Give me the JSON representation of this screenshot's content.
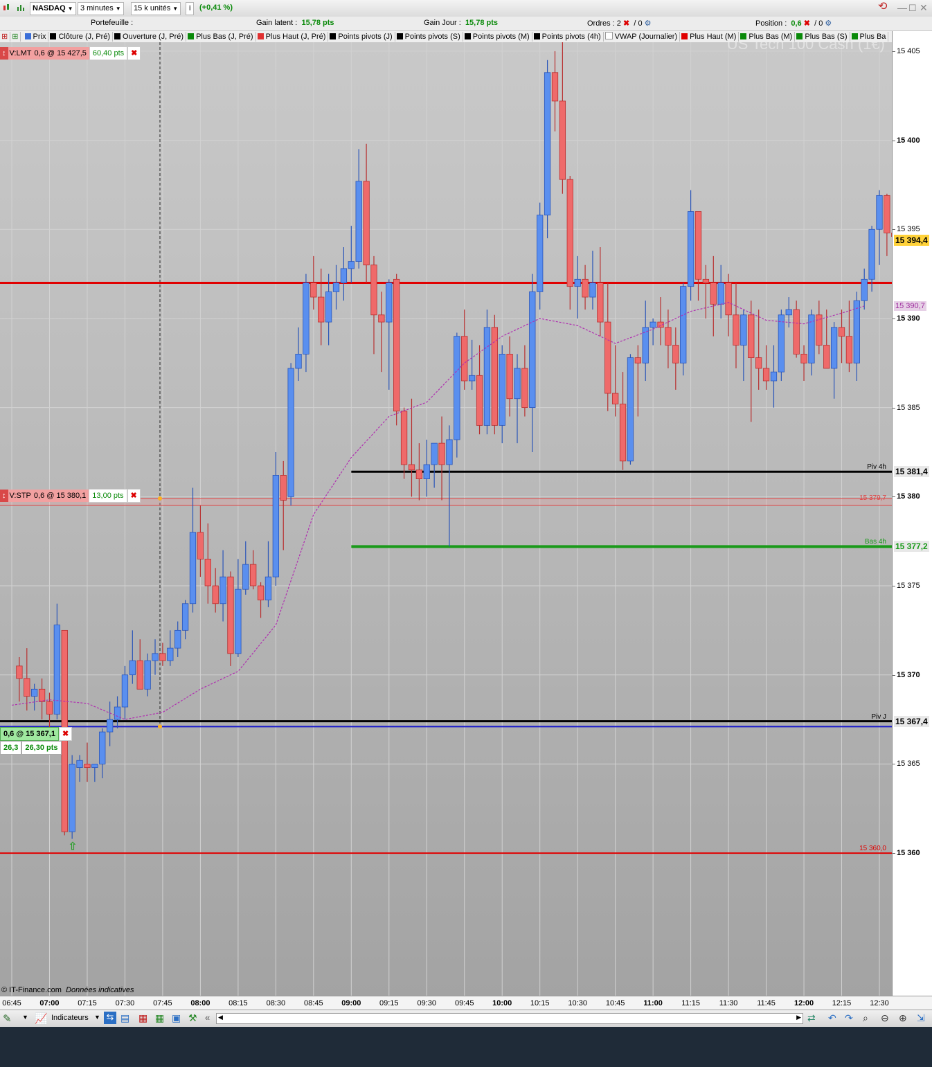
{
  "topbar": {
    "instrument": "NASDAQ",
    "timeframe": "3 minutes",
    "units": "15 k unités",
    "info_icon": "i",
    "change": "(+0,41 %)"
  },
  "infobar": {
    "portfolio_label": "Portefeuille :",
    "unrealized_label": "Gain latent :",
    "unrealized_value": "15,78 pts",
    "day_label": "Gain Jour :",
    "day_value": "15,78 pts",
    "orders_label": "Ordres :",
    "orders_value": "2",
    "orders_sep": "/ 0",
    "position_label": "Position :",
    "position_value": "0,6",
    "position_sep": "/ 0"
  },
  "legend": [
    {
      "label": "Prix",
      "color": "#3b6fd8"
    },
    {
      "label": "Clôture (J, Pré)",
      "color": "#000000"
    },
    {
      "label": "Ouverture (J, Pré)",
      "color": "#000000"
    },
    {
      "label": "Plus Bas (J, Pré)",
      "color": "#0a8a0a"
    },
    {
      "label": "Plus Haut (J, Pré)",
      "color": "#e03030"
    },
    {
      "label": "Points pivots (J)",
      "color": "#000000"
    },
    {
      "label": "Points pivots (S)",
      "color": "#000000"
    },
    {
      "label": "Points pivots (M)",
      "color": "#000000"
    },
    {
      "label": "Points pivots (4h)",
      "color": "#000000"
    },
    {
      "label": "VWAP (Journalier)",
      "color": "#ffffff"
    },
    {
      "label": "Plus Haut (M)",
      "color": "#e00000"
    },
    {
      "label": "Plus Bas (M)",
      "color": "#0a8a0a"
    },
    {
      "label": "Plus Bas (S)",
      "color": "#0a8a0a"
    },
    {
      "label": "Plus Ba",
      "color": "#0a8a0a"
    }
  ],
  "watermark": "US Tech 100 Cash (1€)",
  "orders": {
    "limit": {
      "label": "V:LMT",
      "detail": "0,6 @ 15 427,5",
      "pts": "60,40 pts"
    },
    "stop": {
      "label": "V:STP",
      "detail": "0,6 @ 15 380,1",
      "pts": "13,00 pts"
    },
    "position": {
      "detail": "0,6 @ 15 367,1",
      "qty": "26,3",
      "pts": "26,30 pts"
    }
  },
  "levels": {
    "piv4h": {
      "label": "Piv 4h",
      "value": 15381.4,
      "box": "15 381,4"
    },
    "bas4h": {
      "label": "Bas 4h",
      "value": 15377.2,
      "box": "15 377,2"
    },
    "pivj": {
      "label": "Piv J",
      "value": 15367.4,
      "box": "15 367,4"
    },
    "red_high": {
      "value": 15392.0
    },
    "red_low": {
      "label": "15 360,0",
      "value": 15360.0
    },
    "stop_line": {
      "label": "15 379,7",
      "value": 15379.9
    },
    "entry": {
      "value": 15367.1
    },
    "last_price_box": "15 394,4",
    "vwap_box": "15 390,7"
  },
  "footer": {
    "copyright": "© IT-Finance.com",
    "note": "Données indicatives",
    "indicators_button": "Indicateurs"
  },
  "chart_data": {
    "type": "candlestick",
    "ylim": [
      15352,
      15405.5
    ],
    "y_ticks": [
      {
        "v": 15405,
        "l": "15 405"
      },
      {
        "v": 15400,
        "l": "15 400"
      },
      {
        "v": 15395,
        "l": "15 395"
      },
      {
        "v": 15390,
        "l": "15 390"
      },
      {
        "v": 15385,
        "l": "15 385"
      },
      {
        "v": 15380,
        "l": "15 380"
      },
      {
        "v": 15375,
        "l": "15 375"
      },
      {
        "v": 15370,
        "l": "15 370"
      },
      {
        "v": 15365,
        "l": "15 365"
      },
      {
        "v": 15360,
        "l": "15 360"
      }
    ],
    "x_ticks": [
      "06:45",
      "07:00",
      "07:15",
      "07:30",
      "07:45",
      "08:00",
      "08:15",
      "08:30",
      "08:45",
      "09:00",
      "09:15",
      "09:30",
      "09:45",
      "10:00",
      "10:15",
      "10:30",
      "10:45",
      "11:00",
      "11:15",
      "11:30",
      "11:45",
      "12:00",
      "12:15",
      "12:30"
    ],
    "x_major": [
      "07:00",
      "08:00",
      "09:00",
      "10:00",
      "11:00",
      "12:00"
    ],
    "candles": [
      [
        "06:48",
        15370.5,
        15371.0,
        15368.5,
        15369.8
      ],
      [
        "06:51",
        15369.8,
        15371.5,
        15368.0,
        15368.8
      ],
      [
        "06:54",
        15368.8,
        15369.5,
        15368.0,
        15369.2
      ],
      [
        "06:57",
        15369.2,
        15369.8,
        15367.5,
        15368.5
      ],
      [
        "07:00",
        15368.5,
        15369.0,
        15367.0,
        15367.8
      ],
      [
        "07:03",
        15367.8,
        15374.0,
        15367.5,
        15372.8
      ],
      [
        "07:06",
        15372.5,
        15372.5,
        15361.0,
        15361.2
      ],
      [
        "07:09",
        15361.2,
        15365.5,
        15360.8,
        15365.0
      ],
      [
        "07:12",
        15364.8,
        15365.5,
        15364.0,
        15365.2
      ],
      [
        "07:15",
        15365.0,
        15366.2,
        15364.0,
        15364.8
      ],
      [
        "07:18",
        15364.8,
        15365.0,
        15364.0,
        15365.0
      ],
      [
        "07:21",
        15365.0,
        15367.0,
        15364.2,
        15366.8
      ],
      [
        "07:24",
        15366.8,
        15368.5,
        15366.0,
        15367.5
      ],
      [
        "07:27",
        15367.5,
        15368.8,
        15367.0,
        15368.2
      ],
      [
        "07:30",
        15368.2,
        15370.5,
        15367.5,
        15370.0
      ],
      [
        "07:33",
        15370.0,
        15372.5,
        15369.5,
        15370.8
      ],
      [
        "07:36",
        15370.8,
        15372.0,
        15369.8,
        15369.2
      ],
      [
        "07:39",
        15369.2,
        15371.2,
        15368.8,
        15370.8
      ],
      [
        "07:42",
        15370.8,
        15372.0,
        15370.0,
        15371.2
      ],
      [
        "07:45",
        15371.2,
        15371.8,
        15370.5,
        15370.8
      ],
      [
        "07:48",
        15370.8,
        15372.5,
        15370.5,
        15371.5
      ],
      [
        "07:51",
        15371.5,
        15373.0,
        15371.0,
        15372.5
      ],
      [
        "07:54",
        15372.5,
        15374.2,
        15372.0,
        15374.0
      ],
      [
        "07:57",
        15374.0,
        15380.5,
        15373.5,
        15378.0
      ],
      [
        "08:00",
        15378.0,
        15379.5,
        15375.5,
        15376.5
      ],
      [
        "08:03",
        15376.5,
        15378.5,
        15374.0,
        15375.0
      ],
      [
        "08:06",
        15375.0,
        15376.0,
        15373.5,
        15374.0
      ],
      [
        "08:09",
        15374.0,
        15377.0,
        15373.0,
        15375.5
      ],
      [
        "08:12",
        15375.5,
        15375.8,
        15370.5,
        15371.2
      ],
      [
        "08:15",
        15371.2,
        15376.5,
        15371.0,
        15374.8
      ],
      [
        "08:18",
        15374.8,
        15377.5,
        15374.5,
        15376.2
      ],
      [
        "08:21",
        15376.2,
        15377.0,
        15374.8,
        15375.0
      ],
      [
        "08:24",
        15375.0,
        15375.2,
        15373.2,
        15374.2
      ],
      [
        "08:27",
        15374.2,
        15377.5,
        15373.8,
        15375.5
      ],
      [
        "08:30",
        15375.5,
        15382.5,
        15375.0,
        15381.2
      ],
      [
        "08:33",
        15381.2,
        15382.0,
        15377.0,
        15379.8
      ],
      [
        "08:36",
        15380.0,
        15387.5,
        15379.5,
        15387.2
      ],
      [
        "08:39",
        15387.2,
        15389.5,
        15386.5,
        15388.0
      ],
      [
        "08:42",
        15388.0,
        15392.5,
        15387.0,
        15392.0
      ],
      [
        "08:45",
        15392.0,
        15393.5,
        15390.5,
        15391.2
      ],
      [
        "08:48",
        15391.2,
        15392.8,
        15388.5,
        15389.8
      ],
      [
        "08:51",
        15389.8,
        15392.5,
        15388.5,
        15391.5
      ],
      [
        "08:54",
        15391.5,
        15393.0,
        15390.5,
        15392.0
      ],
      [
        "08:57",
        15392.0,
        15394.0,
        15391.0,
        15392.8
      ],
      [
        "09:00",
        15392.8,
        15395.2,
        15392.0,
        15393.2
      ],
      [
        "09:03",
        15393.2,
        15399.5,
        15392.8,
        15397.7
      ],
      [
        "09:06",
        15397.7,
        15399.8,
        15392.0,
        15393.0
      ],
      [
        "09:09",
        15393.0,
        15393.5,
        15388.0,
        15390.2
      ],
      [
        "09:12",
        15390.2,
        15391.5,
        15387.0,
        15389.8
      ],
      [
        "09:15",
        15389.8,
        15392.2,
        15386.0,
        15392.0
      ],
      [
        "09:18",
        15392.2,
        15392.5,
        15384.0,
        15384.8
      ],
      [
        "09:21",
        15384.8,
        15385.0,
        15381.0,
        15381.8
      ],
      [
        "09:24",
        15381.8,
        15385.5,
        15380.0,
        15381.5
      ],
      [
        "09:27",
        15381.5,
        15383.0,
        15379.8,
        15381.0
      ],
      [
        "09:30",
        15381.0,
        15383.2,
        15380.0,
        15381.8
      ],
      [
        "09:33",
        15381.8,
        15383.0,
        15380.5,
        15383.0
      ],
      [
        "09:36",
        15383.0,
        15384.5,
        15379.8,
        15381.8
      ],
      [
        "09:39",
        15381.8,
        15384.0,
        15377.2,
        15383.2
      ],
      [
        "09:42",
        15383.2,
        15389.2,
        15382.2,
        15389.0
      ],
      [
        "09:45",
        15389.0,
        15390.5,
        15386.0,
        15386.5
      ],
      [
        "09:48",
        15386.5,
        15388.8,
        15386.0,
        15386.8
      ],
      [
        "09:51",
        15386.8,
        15388.5,
        15383.5,
        15384.0
      ],
      [
        "09:54",
        15384.0,
        15390.5,
        15383.5,
        15389.5
      ],
      [
        "09:57",
        15389.5,
        15390.2,
        15383.5,
        15384.0
      ],
      [
        "10:00",
        15384.0,
        15388.5,
        15383.0,
        15388.0
      ],
      [
        "10:03",
        15388.0,
        15389.0,
        15384.5,
        15385.5
      ],
      [
        "10:06",
        15385.5,
        15388.0,
        15383.0,
        15387.2
      ],
      [
        "10:09",
        15387.2,
        15388.5,
        15384.5,
        15385.0
      ],
      [
        "10:12",
        15385.0,
        15392.5,
        15382.5,
        15391.5
      ],
      [
        "10:15",
        15391.5,
        15396.5,
        15390.5,
        15395.8
      ],
      [
        "10:18",
        15395.8,
        15404.5,
        15394.5,
        15403.8
      ],
      [
        "10:21",
        15403.8,
        15405.0,
        15400.5,
        15402.2
      ],
      [
        "10:24",
        15402.2,
        15405.5,
        15397.0,
        15397.8
      ],
      [
        "10:27",
        15397.8,
        15398.0,
        15390.5,
        15391.8
      ],
      [
        "10:30",
        15391.8,
        15393.5,
        15390.0,
        15392.2
      ],
      [
        "10:33",
        15392.2,
        15393.0,
        15390.5,
        15391.2
      ],
      [
        "10:36",
        15391.2,
        15393.8,
        15390.5,
        15392.0
      ],
      [
        "10:39",
        15392.0,
        15394.0,
        15389.0,
        15389.8
      ],
      [
        "10:42",
        15389.8,
        15392.0,
        15384.8,
        15385.8
      ],
      [
        "10:45",
        15385.8,
        15388.5,
        15384.5,
        15385.2
      ],
      [
        "10:48",
        15385.2,
        15387.0,
        15381.5,
        15382.0
      ],
      [
        "10:51",
        15382.0,
        15388.0,
        15381.8,
        15387.8
      ],
      [
        "10:54",
        15387.8,
        15388.5,
        15384.5,
        15387.5
      ],
      [
        "10:57",
        15387.5,
        15391.0,
        15386.5,
        15389.5
      ],
      [
        "11:00",
        15389.5,
        15390.0,
        15388.5,
        15389.8
      ],
      [
        "11:03",
        15389.8,
        15391.2,
        15388.5,
        15389.5
      ],
      [
        "11:06",
        15389.5,
        15390.5,
        15387.2,
        15388.5
      ],
      [
        "11:09",
        15388.5,
        15389.5,
        15386.0,
        15387.5
      ],
      [
        "11:12",
        15387.5,
        15392.0,
        15386.8,
        15391.8
      ],
      [
        "11:15",
        15391.8,
        15397.2,
        15391.0,
        15396.0
      ],
      [
        "11:18",
        15396.0,
        15396.0,
        15391.0,
        15392.2
      ],
      [
        "11:21",
        15392.2,
        15393.0,
        15390.0,
        15392.0
      ],
      [
        "11:24",
        15392.0,
        15393.5,
        15389.0,
        15390.8
      ],
      [
        "11:27",
        15390.8,
        15393.0,
        15390.0,
        15392.0
      ],
      [
        "11:30",
        15392.0,
        15392.5,
        15389.0,
        15390.2
      ],
      [
        "11:33",
        15390.2,
        15392.0,
        15387.2,
        15388.5
      ],
      [
        "11:36",
        15388.5,
        15390.5,
        15386.5,
        15390.2
      ],
      [
        "11:39",
        15390.2,
        15391.0,
        15384.2,
        15387.8
      ],
      [
        "11:42",
        15387.8,
        15390.5,
        15386.0,
        15387.2
      ],
      [
        "11:45",
        15387.2,
        15388.5,
        15386.0,
        15386.5
      ],
      [
        "11:48",
        15386.5,
        15388.5,
        15385.0,
        15387.0
      ],
      [
        "11:51",
        15387.0,
        15390.5,
        15386.5,
        15390.2
      ],
      [
        "11:54",
        15390.2,
        15391.2,
        15389.5,
        15390.5
      ],
      [
        "11:57",
        15390.5,
        15391.0,
        15387.8,
        15388.0
      ],
      [
        "12:00",
        15388.0,
        15388.5,
        15386.5,
        15387.5
      ],
      [
        "12:03",
        15387.5,
        15390.5,
        15386.8,
        15390.2
      ],
      [
        "12:06",
        15390.2,
        15391.0,
        15388.0,
        15388.5
      ],
      [
        "12:09",
        15388.5,
        15390.5,
        15387.5,
        15387.2
      ],
      [
        "12:12",
        15387.2,
        15389.8,
        15385.5,
        15389.5
      ],
      [
        "12:15",
        15389.5,
        15390.5,
        15387.5,
        15389.0
      ],
      [
        "12:18",
        15389.0,
        15391.0,
        15387.0,
        15387.5
      ],
      [
        "12:21",
        15387.5,
        15391.5,
        15386.5,
        15391.0
      ],
      [
        "12:24",
        15391.0,
        15392.8,
        15390.5,
        15392.2
      ],
      [
        "12:27",
        15392.2,
        15395.2,
        15391.5,
        15395.0
      ],
      [
        "12:30",
        15395.0,
        15397.2,
        15393.0,
        15396.9
      ],
      [
        "12:33",
        15396.9,
        15397.0,
        15393.5,
        15394.8
      ],
      [
        "12:36",
        15394.8,
        15395.3,
        15393.2,
        15394.6
      ],
      [
        "12:39",
        15394.6,
        15395.0,
        15393.3,
        15394.4
      ]
    ],
    "vwap": [
      [
        "06:45",
        15368.3
      ],
      [
        "07:00",
        15368.6
      ],
      [
        "07:15",
        15368.4
      ],
      [
        "07:30",
        15367.5
      ],
      [
        "07:45",
        15367.9
      ],
      [
        "08:00",
        15369.2
      ],
      [
        "08:15",
        15370.2
      ],
      [
        "08:30",
        15372.8
      ],
      [
        "08:45",
        15379.0
      ],
      [
        "09:00",
        15382.2
      ],
      [
        "09:15",
        15384.5
      ],
      [
        "09:30",
        15385.3
      ],
      [
        "09:45",
        15387.5
      ],
      [
        "10:00",
        15389.0
      ],
      [
        "10:15",
        15390.0
      ],
      [
        "10:30",
        15389.6
      ],
      [
        "10:45",
        15388.6
      ],
      [
        "11:00",
        15389.4
      ],
      [
        "11:15",
        15390.4
      ],
      [
        "11:30",
        15390.9
      ],
      [
        "11:45",
        15389.9
      ],
      [
        "12:00",
        15389.7
      ],
      [
        "12:15",
        15390.3
      ],
      [
        "12:24",
        15390.7
      ]
    ]
  }
}
